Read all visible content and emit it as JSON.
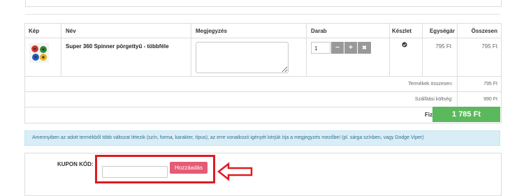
{
  "cart": {
    "headers": {
      "image": "Kép",
      "name": "Név",
      "note": "Megjegyzés",
      "quantity": "Darab",
      "stock": "Készlet",
      "unit_price": "Egységár",
      "total": "Összesen"
    },
    "item": {
      "name": "Super 360 Spinner pörgettyű - többféle",
      "quantity": "1",
      "unit_price": "795 Ft",
      "total": "795 Ft",
      "in_stock_icon": "check-circle-icon"
    },
    "summary": {
      "products_label": "Termékek összesen:",
      "products_value": "795 Ft",
      "shipping_label": "Szállítási költség:",
      "shipping_value": "990 Ft",
      "payable_label": "Fizetendő:",
      "payable_value": "1 785 Ft"
    }
  },
  "info_text": "Amennyiben az adott termékből több változat létezik (szín, forma, karakter, típus), az erre vonatkozó igényét kérjük írja a megjegyzés mezőbe! (pl. sárga színben, vagy Dodge Viper)",
  "coupon": {
    "label": "KUPON KÓD:",
    "input_value": "",
    "button_label": "Hozzáadás"
  },
  "colors": {
    "total_bg": "#5cb85c",
    "coupon_button": "#e55b75",
    "highlight": "#e01a22",
    "info_bg": "#d9edf7"
  }
}
